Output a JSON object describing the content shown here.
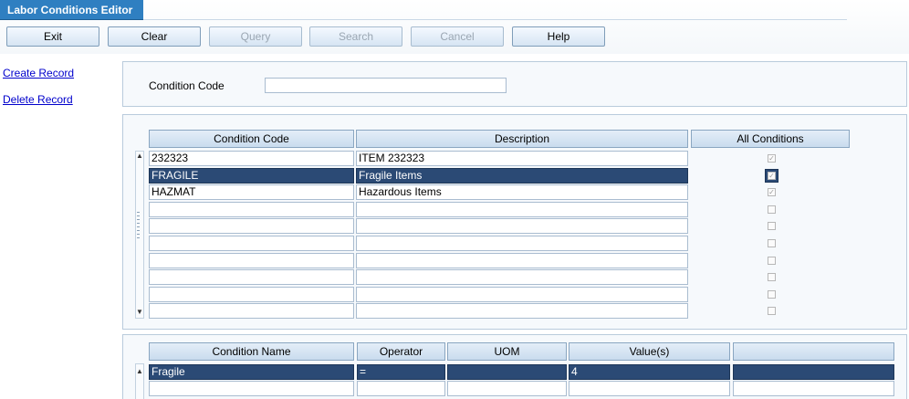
{
  "window": {
    "title": "Labor Conditions Editor"
  },
  "toolbar": {
    "buttons": [
      {
        "label": "Exit",
        "enabled": true
      },
      {
        "label": "Clear",
        "enabled": true
      },
      {
        "label": "Query",
        "enabled": false
      },
      {
        "label": "Search",
        "enabled": false
      },
      {
        "label": "Cancel",
        "enabled": false
      },
      {
        "label": "Help",
        "enabled": true
      }
    ]
  },
  "sidebar": {
    "links": [
      {
        "label": "Create Record"
      },
      {
        "label": "Delete Record"
      }
    ]
  },
  "search_form": {
    "condition_code_label": "Condition Code",
    "condition_code_value": ""
  },
  "conditions_table": {
    "columns": [
      "Condition Code",
      "Description",
      "All Conditions"
    ],
    "rows": [
      {
        "code": "232323",
        "description": "ITEM 232323",
        "all_conditions": true,
        "selected": false
      },
      {
        "code": "FRAGILE",
        "description": "Fragile Items",
        "all_conditions": true,
        "selected": true
      },
      {
        "code": "HAZMAT",
        "description": "Hazardous Items",
        "all_conditions": true,
        "selected": false
      },
      {
        "code": "",
        "description": "",
        "all_conditions": false,
        "selected": false
      },
      {
        "code": "",
        "description": "",
        "all_conditions": false,
        "selected": false
      },
      {
        "code": "",
        "description": "",
        "all_conditions": false,
        "selected": false
      },
      {
        "code": "",
        "description": "",
        "all_conditions": false,
        "selected": false
      },
      {
        "code": "",
        "description": "",
        "all_conditions": false,
        "selected": false
      },
      {
        "code": "",
        "description": "",
        "all_conditions": false,
        "selected": false
      },
      {
        "code": "",
        "description": "",
        "all_conditions": false,
        "selected": false
      }
    ]
  },
  "details_table": {
    "columns": [
      "Condition Name",
      "Operator",
      "UOM",
      "Value(s)",
      ""
    ],
    "rows": [
      {
        "name": "Fragile",
        "operator": "=",
        "uom": "",
        "values": "4",
        "extra": "",
        "selected": true
      },
      {
        "name": "",
        "operator": "",
        "uom": "",
        "values": "",
        "extra": "",
        "selected": false
      }
    ]
  },
  "icons": {
    "scroll_up": "scroll-up-arrow-icon",
    "scroll_down": "scroll-down-arrow-icon",
    "checkmark": "checkmark-icon"
  },
  "colors": {
    "title_tab": "#2f7fc1",
    "selected_row": "#2b4a75",
    "link": "#0000cc"
  }
}
